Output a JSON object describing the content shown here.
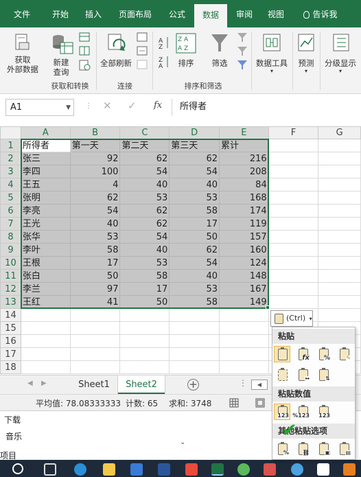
{
  "ribbon_tabs": [
    "文件",
    "开始",
    "插入",
    "页面布局",
    "公式",
    "数据",
    "审阅",
    "视图"
  ],
  "tell_me": "告诉我",
  "ribbon": {
    "get_external": "获取\n外部数据",
    "new_query": "新建\n查询",
    "refresh_all": "全部刷新",
    "sort": "排序",
    "filter": "筛选",
    "data_tools": "数据工具",
    "forecast": "预测",
    "outline": "分级显示",
    "group_get_transform": "获取和转换",
    "group_connections": "连接",
    "group_sort_filter": "排序和筛选"
  },
  "formula_bar": {
    "name_box": "A1",
    "formula": "所得者",
    "fx": "fx"
  },
  "columns": [
    "A",
    "B",
    "C",
    "D",
    "E",
    "F",
    "G"
  ],
  "table": {
    "header": [
      "所得者",
      "第一天",
      "第二天",
      "第三天",
      "累计"
    ],
    "rows": [
      [
        "张三",
        "92",
        "62",
        "62",
        "216"
      ],
      [
        "李四",
        "100",
        "54",
        "54",
        "208"
      ],
      [
        "王五",
        "4",
        "40",
        "40",
        "84"
      ],
      [
        "张明",
        "62",
        "53",
        "53",
        "168"
      ],
      [
        "李亮",
        "54",
        "62",
        "58",
        "174"
      ],
      [
        "王光",
        "40",
        "62",
        "17",
        "119"
      ],
      [
        "张华",
        "53",
        "54",
        "50",
        "157"
      ],
      [
        "李叶",
        "58",
        "40",
        "62",
        "160"
      ],
      [
        "王根",
        "17",
        "53",
        "54",
        "124"
      ],
      [
        "张白",
        "50",
        "58",
        "40",
        "148"
      ],
      [
        "李兰",
        "97",
        "17",
        "53",
        "167"
      ],
      [
        "王红",
        "41",
        "50",
        "58",
        "149"
      ]
    ]
  },
  "row_numbers": [
    "1",
    "2",
    "3",
    "4",
    "5",
    "6",
    "7",
    "8",
    "9",
    "10",
    "11",
    "12",
    "13",
    "14",
    "15",
    "16",
    "17",
    "18"
  ],
  "sheets": [
    "Sheet1",
    "Sheet2"
  ],
  "status": {
    "average": "平均值: 78.08333333",
    "count": "计数: 65",
    "sum": "求和: 3748"
  },
  "paste_options": {
    "button_label": "(Ctrl)",
    "section_paste": "粘贴",
    "section_values": "粘贴数值",
    "section_other": "其他粘贴选项"
  },
  "behind_window": {
    "items": [
      "下载",
      "音乐",
      "项目"
    ]
  },
  "colors": {
    "excel_green": "#217346",
    "selection": "#c6c6c6",
    "taskbar": "#1e2a3a"
  }
}
